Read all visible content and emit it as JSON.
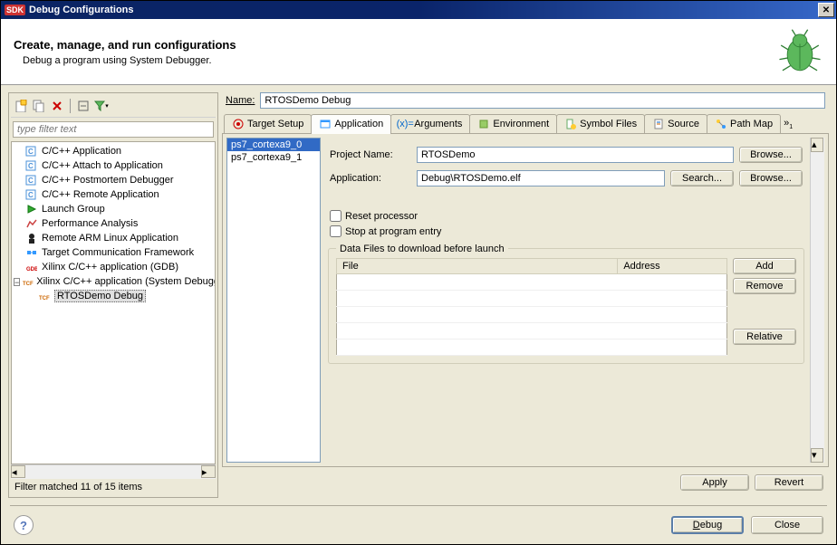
{
  "window": {
    "title": "Debug Configurations",
    "header_title": "Create, manage, and run configurations",
    "header_subtitle": "Debug a program using System Debugger."
  },
  "filter": {
    "placeholder": "type filter text",
    "status": "Filter matched 11 of 15 items"
  },
  "tree": {
    "items": [
      "C/C++ Application",
      "C/C++ Attach to Application",
      "C/C++ Postmortem Debugger",
      "C/C++ Remote Application",
      "Launch Group",
      "Performance Analysis",
      "Remote ARM Linux Application",
      "Target Communication Framework",
      "Xilinx C/C++ application (GDB)",
      "Xilinx C/C++ application (System Debugger)"
    ],
    "child": "RTOSDemo Debug"
  },
  "name_field": {
    "label": "Name:",
    "value": "RTOSDemo Debug"
  },
  "tabs": {
    "items": [
      "Target Setup",
      "Application",
      "Arguments",
      "Environment",
      "Symbol Files",
      "Source",
      "Path Map"
    ],
    "active": 1
  },
  "cores": {
    "items": [
      "ps7_cortexa9_0",
      "ps7_cortexa9_1"
    ],
    "selected": 0
  },
  "form": {
    "project_label": "Project Name:",
    "project_value": "RTOSDemo",
    "app_label": "Application:",
    "app_value": "Debug\\RTOSDemo.elf",
    "browse": "Browse...",
    "search": "Search...",
    "reset_cb": "Reset processor",
    "stop_cb": "Stop at program entry"
  },
  "datafiles": {
    "title": "Data Files to download before launch",
    "col_file": "File",
    "col_addr": "Address",
    "add": "Add",
    "remove": "Remove",
    "relative": "Relative"
  },
  "buttons": {
    "apply": "Apply",
    "revert": "Revert",
    "debug": "Debug",
    "close": "Close"
  }
}
